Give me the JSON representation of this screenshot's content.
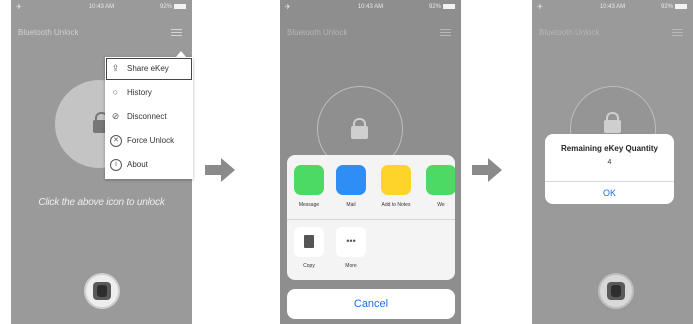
{
  "panel1": {
    "status": {
      "plane": "✈",
      "time": "10:43 AM",
      "battery": "92%"
    },
    "nav_title": "Bluetooth Unlock",
    "menu": [
      {
        "label": "Share eKey",
        "icon": "share-icon",
        "glyph": "⇪"
      },
      {
        "label": "History",
        "icon": "search-icon",
        "glyph": "○"
      },
      {
        "label": "Disconnect",
        "icon": "disconnect-icon",
        "glyph": "⊘"
      },
      {
        "label": "Force Unlock",
        "icon": "force-unlock-icon",
        "glyph": "✕"
      },
      {
        "label": "About",
        "icon": "info-icon",
        "glyph": "i"
      }
    ],
    "hint": "Click the above icon to unlock"
  },
  "panel2": {
    "status": {
      "plane": "✈",
      "time": "10:43 AM",
      "battery": "92%"
    },
    "nav_title": "Bluetooth Unlock",
    "apps": [
      {
        "label": "Message",
        "icon": "message-icon",
        "color": "#4cd964"
      },
      {
        "label": "Mail",
        "icon": "mail-icon",
        "color": "#2f8ef5"
      },
      {
        "label": "Add to Notes",
        "icon": "notes-icon",
        "color": "#ffd42a"
      },
      {
        "label": "We",
        "icon": "wechat-icon",
        "color": "#4cd964"
      }
    ],
    "actions": [
      {
        "label": "Copy",
        "icon": "copy-icon"
      },
      {
        "label": "More",
        "icon": "more-icon"
      }
    ],
    "cancel": "Cancel"
  },
  "panel3": {
    "status": {
      "plane": "✈",
      "time": "10:43 AM",
      "battery": "92%"
    },
    "nav_title": "Bluetooth Unlock",
    "alert": {
      "title": "Remaining eKey Quantity",
      "quantity": "4",
      "ok": "OK"
    }
  }
}
